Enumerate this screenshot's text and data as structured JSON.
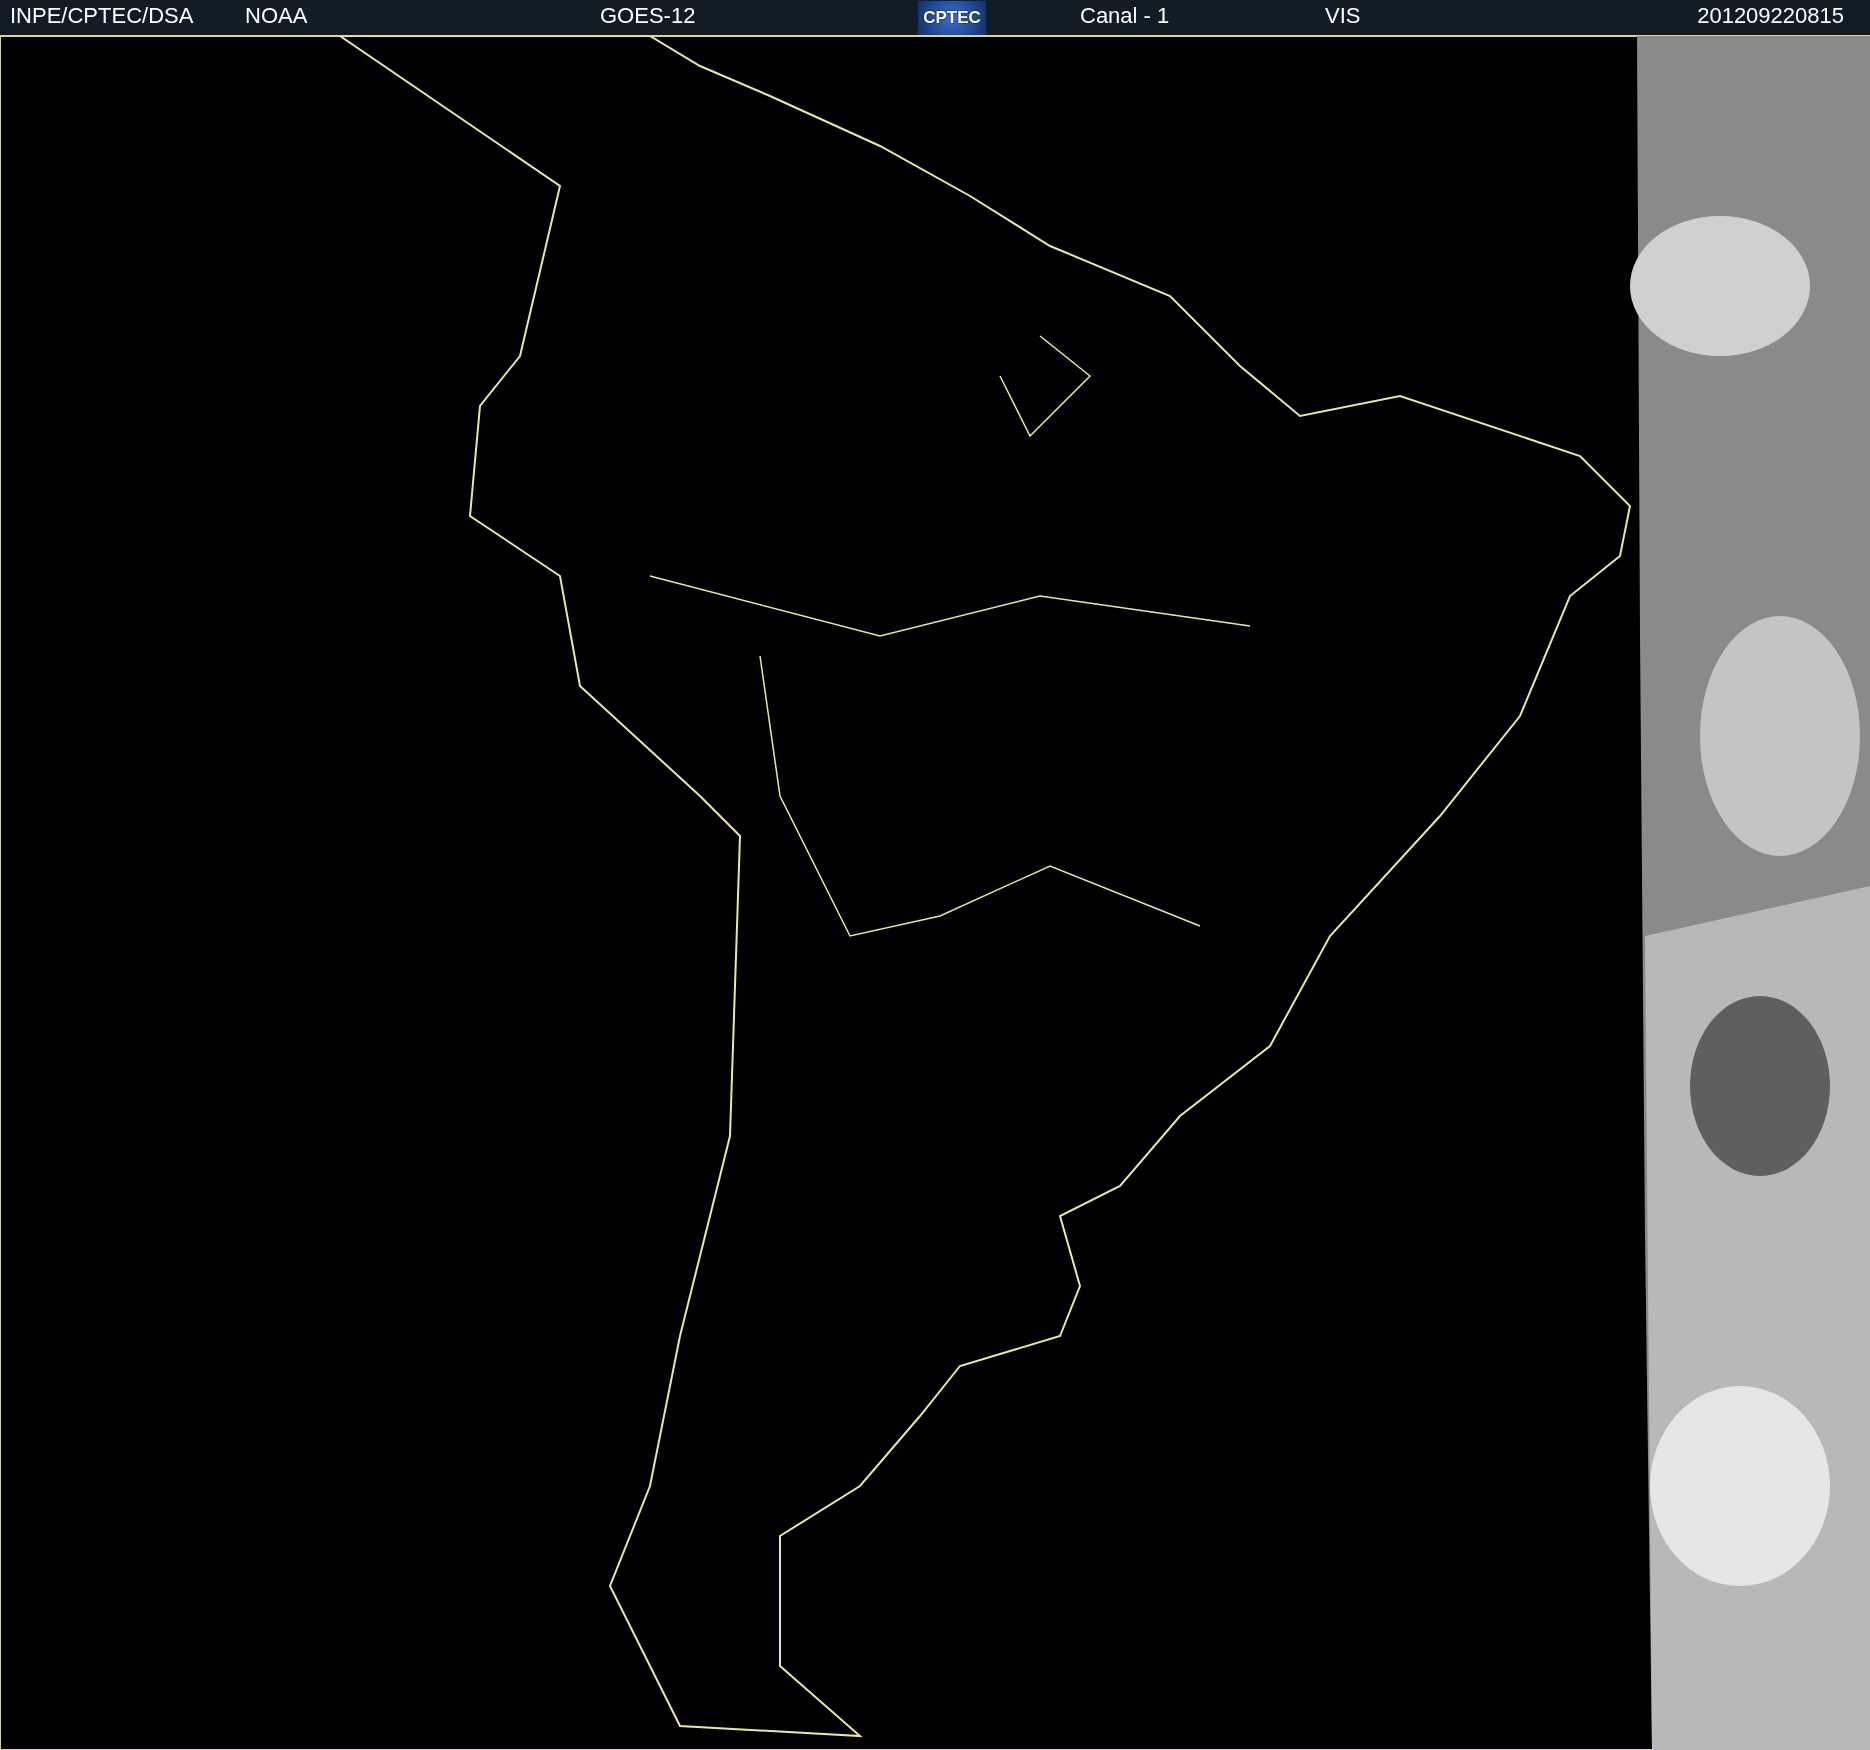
{
  "header": {
    "source": "INPE/CPTEC/DSA",
    "agency": "NOAA",
    "satellite": "GOES-12",
    "logo": "CPTEC",
    "channel": "Canal - 1",
    "band": "VIS",
    "timestamp": "201209220815"
  }
}
